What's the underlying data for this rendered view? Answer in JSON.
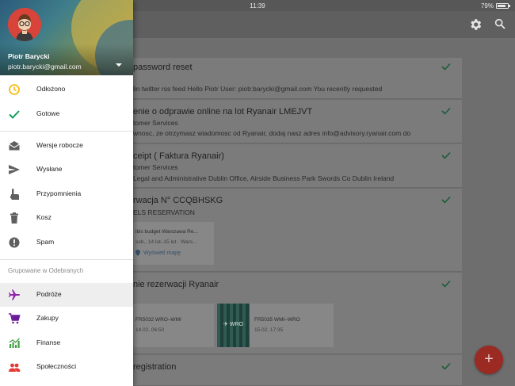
{
  "status_bar": {
    "time": "11:39",
    "battery": "79%"
  },
  "toolbar": {
    "settings_icon": "gear-icon",
    "search_icon": "search-icon"
  },
  "inbox": {
    "items": [
      {
        "title": "password reset",
        "snippet": "lin twitter rss feed Hello Piotr User: piotr.barycki@gmail.com You recently requested"
      },
      {
        "title": "enie o odprawie online na lot Ryanair LMEJVT",
        "sender": "tomer Services",
        "snippet": "wnosc, ze otrzymasz wiadomosc od Ryanair, dodaj nasz adres info@advisory.ryanair.com do"
      },
      {
        "title": "ceipt ( Faktura Ryanair)",
        "sender": "tomer Services",
        "snippet": "Legal and Administrative Dublin Office, Airside Business Park Swords Co Dublin Ireland"
      },
      {
        "title": "rwacja N° CCQBHSKG",
        "sender": "ELS RESERVATION",
        "tile": {
          "name": "ibis budget Warszawa Re...",
          "dates": "sob., 14 lut–15 lut · Wars...",
          "map_link": "Wyświetl mapę"
        }
      },
      {
        "title": "nie rezerwacji Ryanair",
        "flights": [
          {
            "route": "FR5032 WRO–WMI",
            "time": "14.02, 06:50"
          },
          {
            "route": "FR5035 WMI–WRO",
            "time": "15.02, 17:35",
            "thumb_label": "WRO"
          }
        ]
      },
      {
        "title": "registration"
      }
    ]
  },
  "fab": {
    "label": "+"
  },
  "drawer": {
    "user_name": "Piotr Barycki",
    "user_email": "piotr.barycki@gmail.com",
    "items_top": [
      {
        "label": "Odłożono",
        "icon": "clock-icon",
        "color": "#f6b400"
      },
      {
        "label": "Gotowe",
        "icon": "check-icon",
        "color": "#0f9d58"
      }
    ],
    "items_mid": [
      {
        "label": "Wersje robocze",
        "icon": "drafts-icon"
      },
      {
        "label": "Wysłane",
        "icon": "send-icon"
      },
      {
        "label": "Przypomnienia",
        "icon": "reminder-icon"
      },
      {
        "label": "Kosz",
        "icon": "trash-icon"
      },
      {
        "label": "Spam",
        "icon": "spam-icon"
      }
    ],
    "section_label": "Grupowane w Odebranych",
    "items_groups": [
      {
        "label": "Podróże",
        "icon": "plane-icon",
        "color": "#8e24aa"
      },
      {
        "label": "Zakupy",
        "icon": "cart-icon",
        "color": "#6a1b9a"
      },
      {
        "label": "Finanse",
        "icon": "finance-icon",
        "color": "#43a047"
      },
      {
        "label": "Społeczności",
        "icon": "people-icon",
        "color": "#e53935"
      }
    ]
  }
}
